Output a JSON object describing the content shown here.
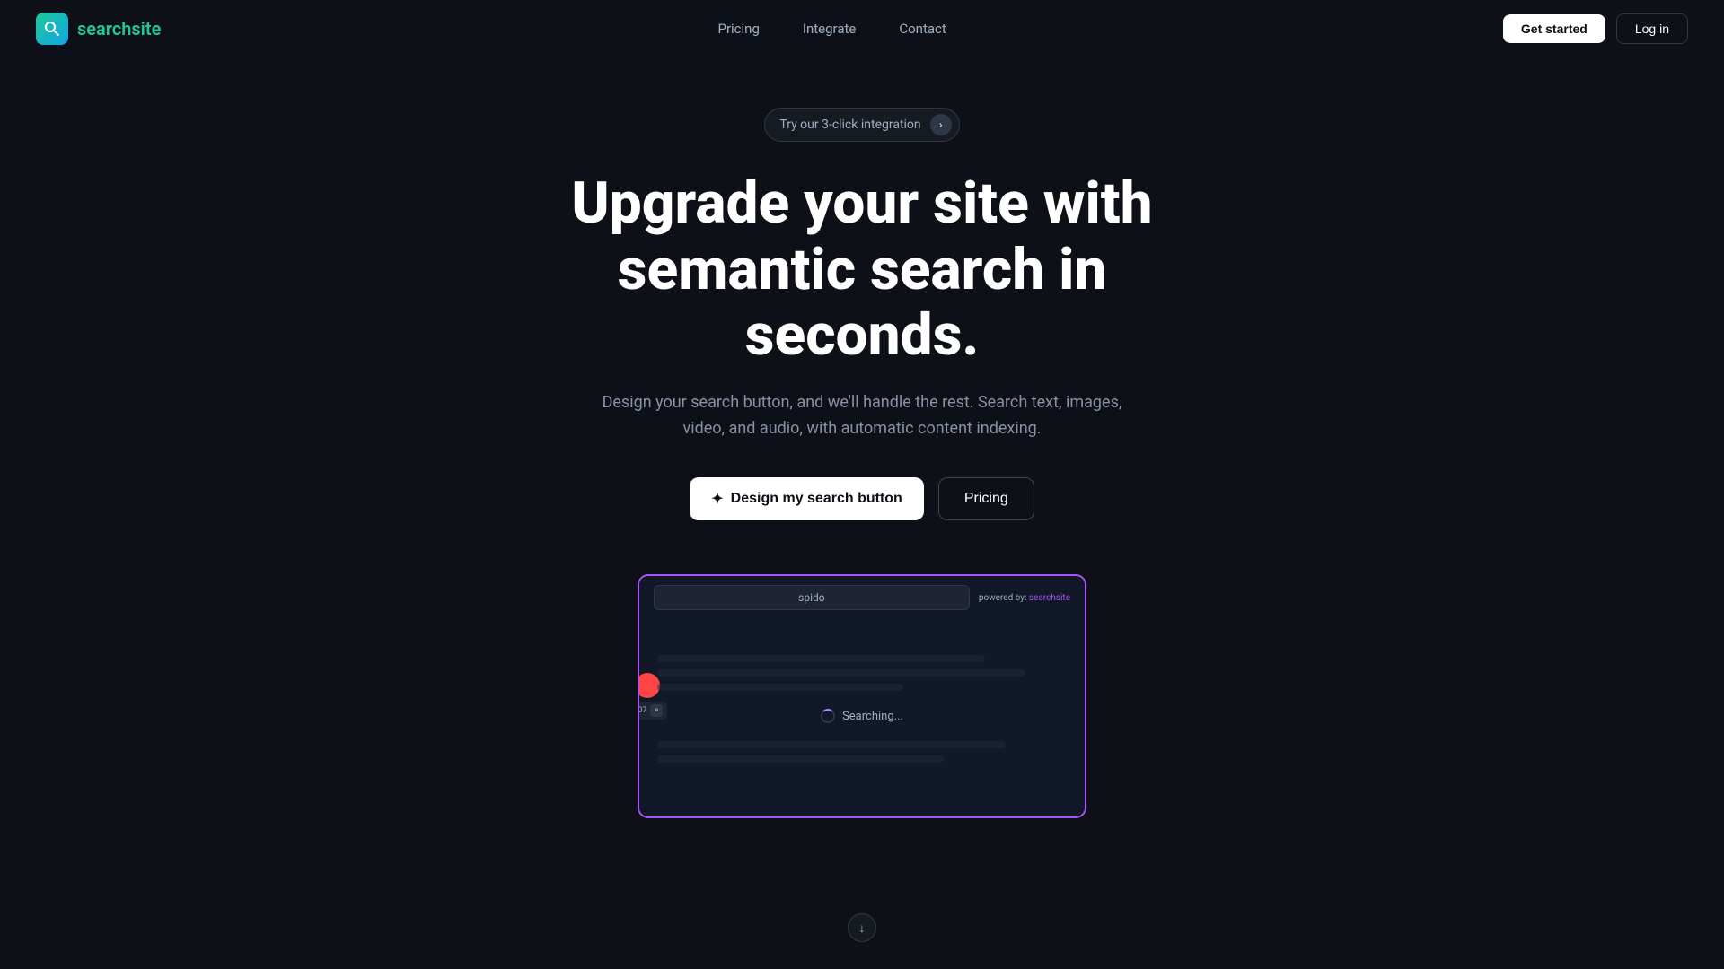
{
  "navbar": {
    "logo_text_search": "search",
    "logo_text_site": "site",
    "links": [
      {
        "label": "Pricing",
        "id": "pricing"
      },
      {
        "label": "Integrate",
        "id": "integrate"
      },
      {
        "label": "Contact",
        "id": "contact"
      }
    ],
    "get_started": "Get started",
    "log_in": "Log in"
  },
  "hero": {
    "badge_text": "Try our 3-click integration",
    "title_line1": "Upgrade your site with",
    "title_line2": "semantic search in seconds.",
    "subtitle": "Design your search button, and we'll handle the rest. Search text, images, video, and audio, with automatic content indexing.",
    "btn_design": "Design my search button",
    "btn_pricing": "Pricing"
  },
  "demo": {
    "search_placeholder": "spido",
    "powered_by": "powered by: searchsite",
    "searching_text": "Searching...",
    "brand_label": "searchsite"
  },
  "colors": {
    "accent_purple": "#a855f7",
    "accent_green": "#20c997",
    "background": "#0d1117"
  }
}
